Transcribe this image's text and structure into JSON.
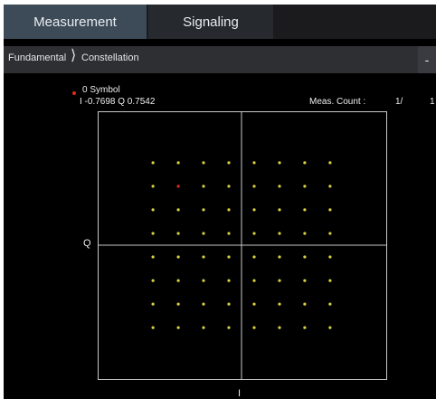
{
  "tabs": [
    {
      "label": "Measurement",
      "active": true
    },
    {
      "label": "Signaling",
      "active": false
    }
  ],
  "breadcrumb": {
    "items": [
      "Fundamental",
      "Constellation"
    ],
    "separator": "⟩",
    "collapse_label": "-"
  },
  "readout": {
    "symbol_label": "0 Symbol",
    "iq_text": "I -0.7698 Q 0.7542",
    "meas_count_label": "Meas. Count :",
    "meas_count_value": "1/",
    "meas_count_total": "1"
  },
  "constellation": {
    "x_axis_label": "I",
    "y_axis_label": "Q",
    "type": "scatter",
    "point_color": "#d8d040",
    "marker_color": "#e02a1a",
    "levels": [
      -0.7698,
      -0.5498,
      -0.3299,
      -0.11,
      0.11,
      0.3299,
      0.5498,
      0.7698
    ],
    "xlim": [
      -1.25,
      1.25
    ],
    "ylim": [
      -1.25,
      1.25
    ],
    "selected_point": {
      "i": -0.5498,
      "q": 0.5498
    }
  }
}
